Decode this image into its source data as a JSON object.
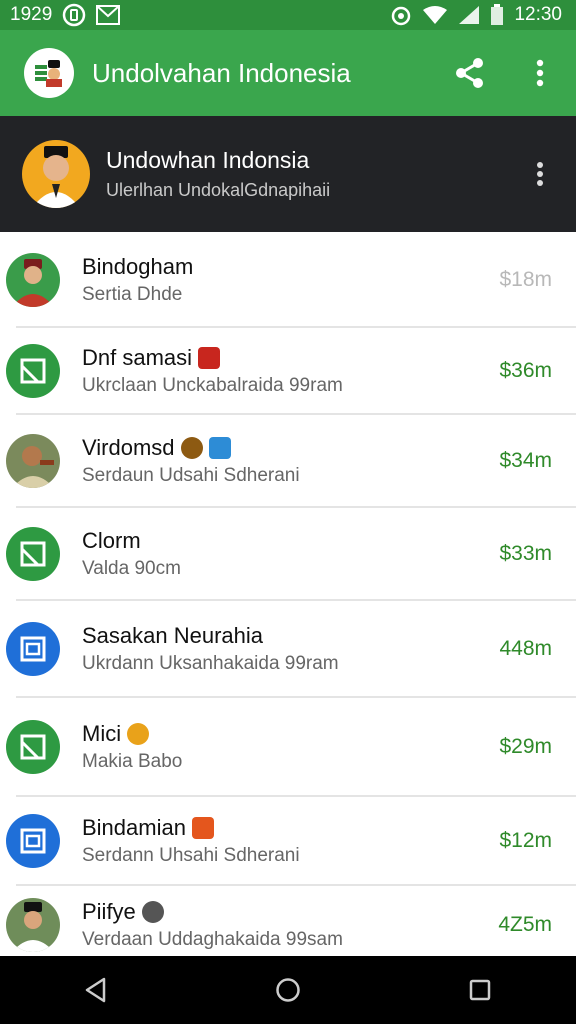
{
  "status_bar": {
    "time_left": "1929",
    "time_right": "12:30",
    "icons": [
      "notification-icon",
      "mail-icon",
      "alarm-icon",
      "wifi-icon",
      "signal-icon",
      "battery-icon"
    ]
  },
  "app_bar": {
    "title": "Undolvahan Indonesia",
    "actions": [
      "share-icon",
      "more-vert-icon"
    ],
    "color": "#3aa64d"
  },
  "profile": {
    "name": "Undowhan Indonsia",
    "subtitle": "Ulerlhan UndokalGdnapihaii"
  },
  "list": {
    "items": [
      {
        "title": "Bindogham",
        "subtitle": "Sertia Dhde",
        "value": "$18m",
        "value_muted": true,
        "avatar": "photo",
        "badge": ""
      },
      {
        "title": "Dnf samasi",
        "subtitle": "Ukrclaan Unckabalraida 99ram",
        "value": "$36m",
        "avatar": "green-doc",
        "badge": "red"
      },
      {
        "title": "Virdomsd",
        "subtitle": "Serdaun Udsahi Sdherani",
        "value": "$34m",
        "avatar": "photo",
        "badge": "coin"
      },
      {
        "title": "Clorm",
        "subtitle": "Valda 90cm",
        "value": "$33m",
        "avatar": "green-doc",
        "badge": ""
      },
      {
        "title": "Sasakan Neurahia",
        "subtitle": "Ukrdann Uksanhakaida 99ram",
        "value": "448m",
        "avatar": "blue-doc",
        "badge": ""
      },
      {
        "title": "Mici",
        "subtitle": "Makia Babo",
        "value": "$29m",
        "avatar": "green-doc",
        "badge": "burst"
      },
      {
        "title": "Bindamian",
        "subtitle": "Serdann Uhsahi Sdherani",
        "value": "$12m",
        "avatar": "blue-doc",
        "badge": "orange"
      },
      {
        "title": "Piifye",
        "subtitle": "Verdaan Uddaghakaida 99sam",
        "value": "4Z5m",
        "avatar": "photo",
        "badge": "gray"
      }
    ]
  },
  "nav_bar": {
    "buttons": [
      "back-icon",
      "home-icon",
      "recents-icon"
    ]
  }
}
